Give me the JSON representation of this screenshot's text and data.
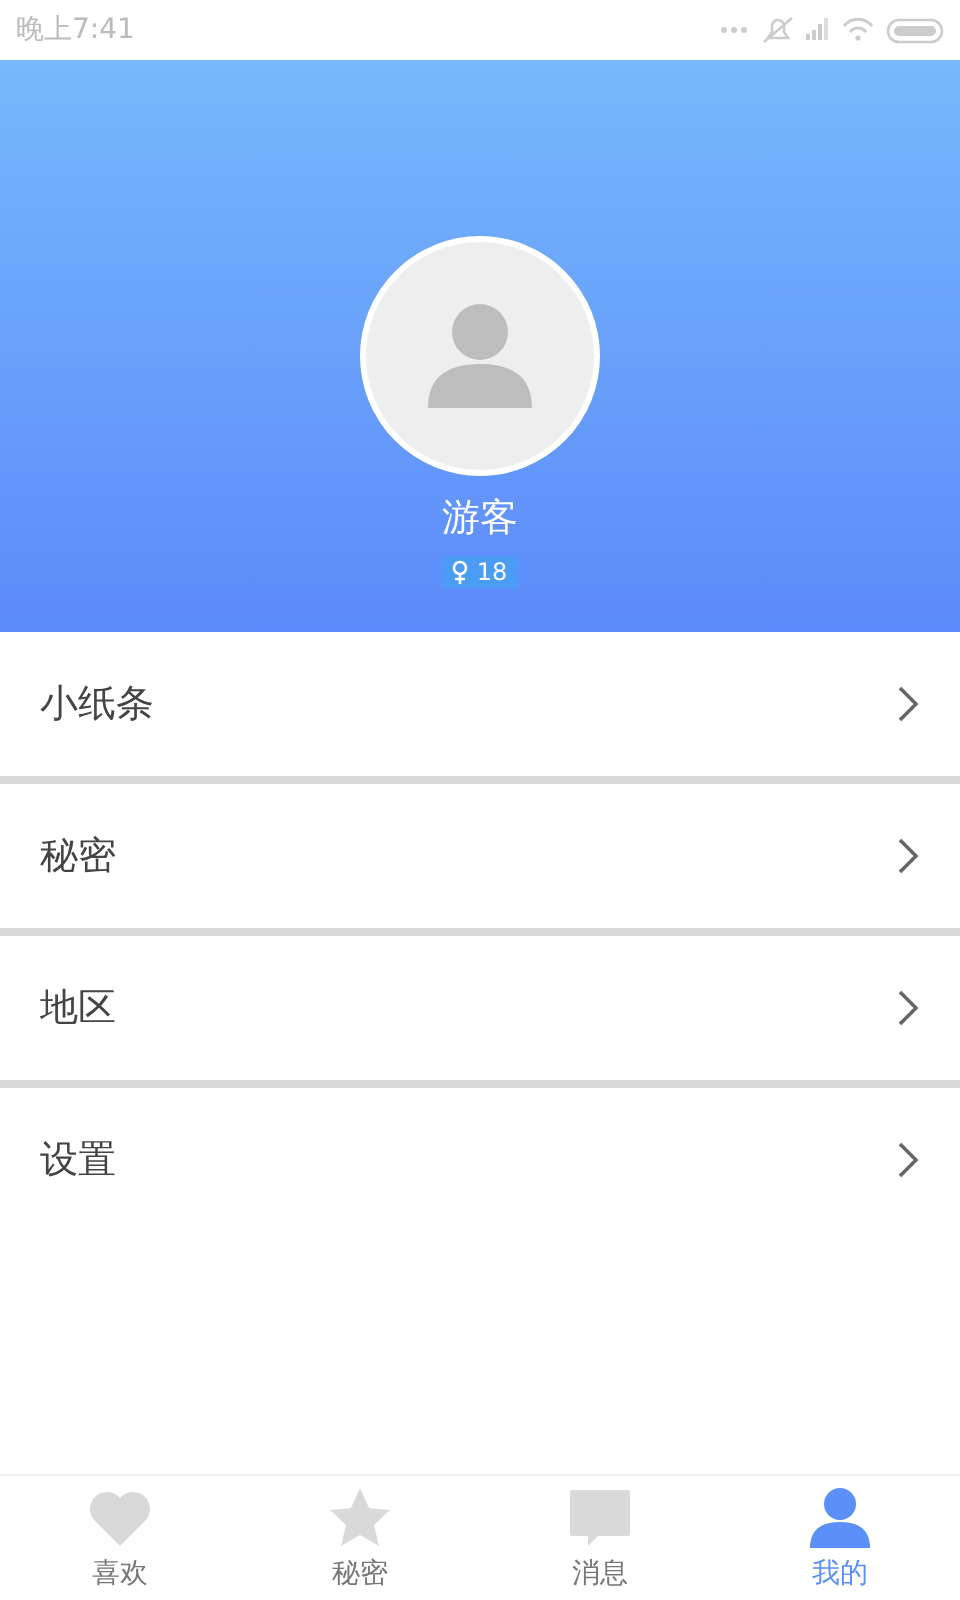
{
  "status_bar": {
    "time": "晚上7:41"
  },
  "profile": {
    "name": "游客",
    "age": "18"
  },
  "menu": [
    {
      "label": "小纸条"
    },
    {
      "label": "秘密"
    },
    {
      "label": "地区"
    },
    {
      "label": "设置"
    }
  ],
  "tabs": [
    {
      "kind": "heart",
      "label": "喜欢",
      "selected": false
    },
    {
      "kind": "star",
      "label": "秘密",
      "selected": false
    },
    {
      "kind": "chat",
      "label": "消息",
      "selected": false
    },
    {
      "kind": "person",
      "label": "我的",
      "selected": true
    }
  ]
}
